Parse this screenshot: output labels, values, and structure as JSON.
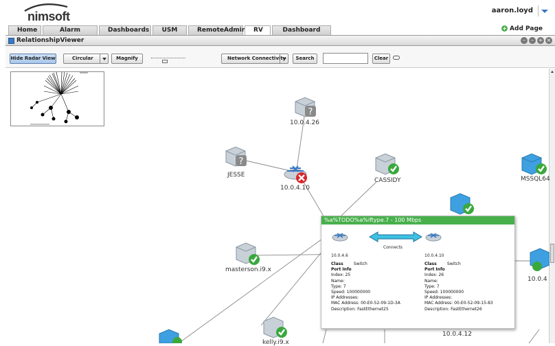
{
  "header": {
    "logo_text": "nimsoft",
    "user": "aaron.loyd"
  },
  "tabs": [
    {
      "label": "Home"
    },
    {
      "label": "Alarm Console"
    },
    {
      "label": "Dashboards"
    },
    {
      "label": "USM"
    },
    {
      "label": "RemoteAdmin"
    },
    {
      "label": "RV",
      "active": true
    },
    {
      "label": "Dashboard Des"
    }
  ],
  "add_page_label": "Add Page",
  "portlet": {
    "title": "RelationshipViewer"
  },
  "toolbar": {
    "hide_radar_label": "Hide Radar View",
    "layout_label": "Circular",
    "magnify_label": "Magnify",
    "view_label": "Network Connectivity",
    "search_label": "Search",
    "search_value": "",
    "clear_label": "Clear"
  },
  "nodes": [
    {
      "label": "10.0.4.26",
      "status": "unknown",
      "kind": "server"
    },
    {
      "label": "JESSE",
      "status": "unknown",
      "kind": "server"
    },
    {
      "label": "10.0.4.10",
      "status": "critical",
      "kind": "switch"
    },
    {
      "label": "CASSIDY",
      "status": "ok",
      "kind": "server"
    },
    {
      "label": "MSSQL64",
      "status": "ok",
      "kind": "server"
    },
    {
      "label": "masterson.i9.x",
      "status": "ok",
      "kind": "server"
    },
    {
      "label": "10.0.4",
      "status": "ok",
      "kind": "switch"
    },
    {
      "label": "10.0.4.12",
      "status": "ok",
      "kind": "server"
    },
    {
      "label": "kelly.i9.x",
      "status": "ok",
      "kind": "server"
    }
  ],
  "popup": {
    "title": "%a%TODO%a%iftype.7 - 100 Mbps",
    "connects_label": "Connects",
    "left": {
      "device": "10.0.4.6",
      "class_label": "Class",
      "class_value": "Switch",
      "port_info_label": "Port Info",
      "lines": [
        "Index: 25",
        "Name:",
        "Type: 7",
        "Speed: 100000000",
        "IP Addresses:",
        "MAC Address: 00-E0-52-09-1D-3A",
        "Description: FastEthernet25"
      ]
    },
    "right": {
      "device": "10.0.4.10",
      "class_label": "Class",
      "class_value": "Switch",
      "port_info_label": "Port Info",
      "lines": [
        "Index: 26",
        "Name:",
        "Type: 7",
        "Speed: 100000000",
        "IP Addresses:",
        "MAC Address: 00-E0-52-09-15-83",
        "Description: FastEthernet26"
      ]
    }
  },
  "colors": {
    "ok": "#3aa83d",
    "critical": "#d9262c",
    "unknown": "#8a8a8a",
    "popup_header": "#47b04b",
    "accent": "#3a78c4"
  }
}
